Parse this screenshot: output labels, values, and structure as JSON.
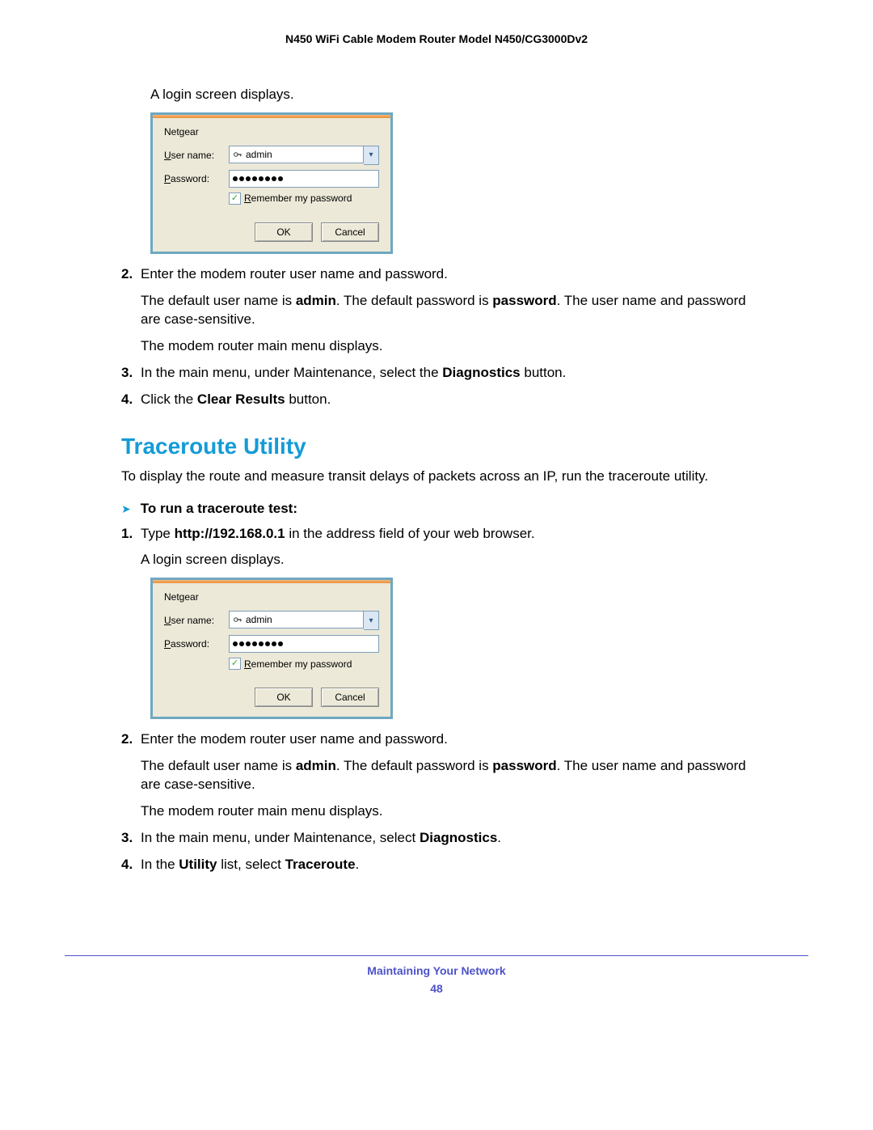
{
  "header": {
    "title": "N450 WiFi Cable Modem Router Model N450/CG3000Dv2"
  },
  "section1": {
    "login_intro": "A login screen displays.",
    "step2": {
      "num": "2.",
      "text": "Enter the modem router user name and password.",
      "p1_a": "The default user name is ",
      "p1_b": "admin",
      "p1_c": ". The default password is ",
      "p1_d": "password",
      "p1_e": ". The user name and password are case-sensitive.",
      "p2": "The modem router main menu displays."
    },
    "step3": {
      "num": "3.",
      "t1": "In the main menu, under Maintenance, select the ",
      "b1": "Diagnostics",
      "t2": " button."
    },
    "step4": {
      "num": "4.",
      "t1": "Click the ",
      "b1": "Clear Results",
      "t2": " button."
    }
  },
  "section2": {
    "title": "Traceroute Utility",
    "intro": "To display the route and measure transit delays of packets across an IP, run the traceroute utility.",
    "proc_title": "To run a traceroute test:",
    "step1": {
      "num": "1.",
      "t1": "Type ",
      "b1": "http://192.168.0.1",
      "t2": " in the address field of your web browser.",
      "p2": "A login screen displays."
    },
    "step2": {
      "num": "2.",
      "text": "Enter the modem router user name and password.",
      "p1_a": "The default user name is ",
      "p1_b": "admin",
      "p1_c": ". The default password is ",
      "p1_d": "password",
      "p1_e": ". The user name and password are case-sensitive.",
      "p2": "The modem router main menu displays."
    },
    "step3": {
      "num": "3.",
      "t1": "In the main menu, under Maintenance, select ",
      "b1": "Diagnostics",
      "t2": "."
    },
    "step4": {
      "num": "4.",
      "t1": "In the ",
      "b1": "Utility",
      "t2": " list, select ",
      "b2": "Traceroute",
      "t3": "."
    }
  },
  "dialog": {
    "realm": "Netgear",
    "user_label_u": "U",
    "user_label_rest": "ser name:",
    "pass_label_u": "P",
    "pass_label_rest": "assword:",
    "user_value": "admin",
    "remember_u": "R",
    "remember_rest": "emember my password",
    "ok": "OK",
    "cancel": "Cancel"
  },
  "footer": {
    "text": "Maintaining Your Network",
    "page": "48"
  }
}
